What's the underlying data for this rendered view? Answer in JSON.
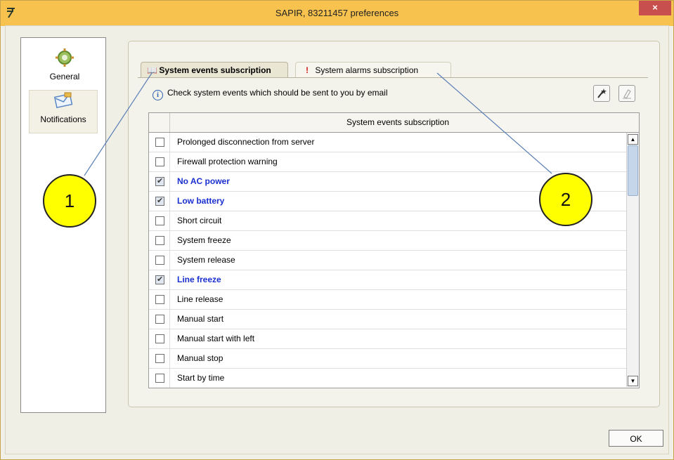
{
  "window": {
    "title": "SAPIR, 83211457 preferences",
    "close_label": "×",
    "titlebar_color": "#f8c24e"
  },
  "sidebar": {
    "items": [
      {
        "label": "General",
        "icon": "gear-icon"
      },
      {
        "label": "Notifications",
        "icon": "envelope-icon",
        "selected": true
      }
    ]
  },
  "tabs": [
    {
      "label": "System events subscription",
      "icon": "book-icon",
      "active": true
    },
    {
      "label": "System alarms subscription",
      "icon": "exclamation-icon",
      "active": false
    }
  ],
  "info_text": "Check system events which should be sent to you by email",
  "table": {
    "header": "System events subscription",
    "rows": [
      {
        "label": "Prolonged disconnection from server",
        "checked": false
      },
      {
        "label": "Firewall protection warning",
        "checked": false
      },
      {
        "label": "No AC power",
        "checked": true
      },
      {
        "label": "Low battery",
        "checked": true
      },
      {
        "label": "Short circuit",
        "checked": false
      },
      {
        "label": "System freeze",
        "checked": false
      },
      {
        "label": "System release",
        "checked": false
      },
      {
        "label": "Line freeze",
        "checked": true
      },
      {
        "label": "Line release",
        "checked": false
      },
      {
        "label": "Manual start",
        "checked": false
      },
      {
        "label": "Manual start with left",
        "checked": false
      },
      {
        "label": "Manual stop",
        "checked": false
      },
      {
        "label": "Start by time",
        "checked": false
      }
    ]
  },
  "buttons": {
    "ok_label": "OK"
  },
  "callouts": [
    {
      "label": "1"
    },
    {
      "label": "2"
    }
  ],
  "colors": {
    "checked_text": "#1a2fd0",
    "callout_fill": "#ffff00"
  }
}
